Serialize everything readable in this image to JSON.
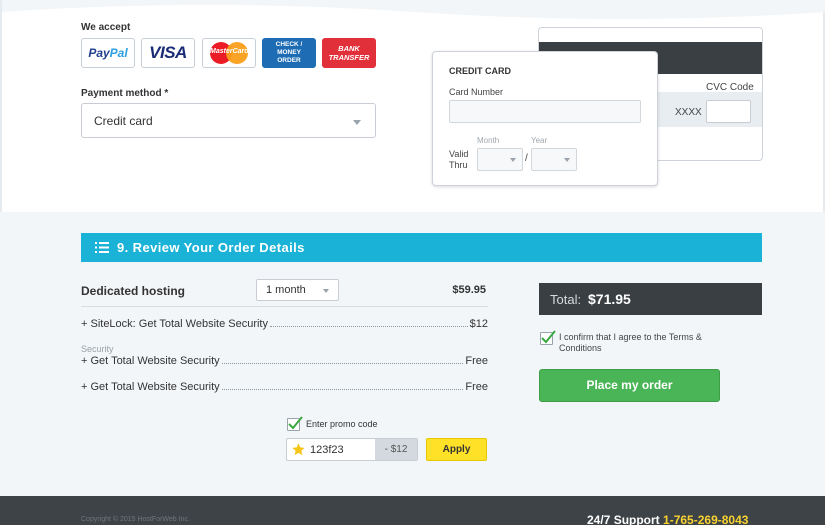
{
  "payment": {
    "we_accept_label": "We accept",
    "logos": {
      "paypal_a": "Pay",
      "paypal_b": "Pal",
      "visa": "VISA",
      "mastercard": "MasterCard",
      "check_line1": "CHECK /",
      "check_line2": "MONEY ORDER",
      "bank_line1": "BANK",
      "bank_line2": "TRANSFER"
    },
    "method_label": "Payment method *",
    "method_value": "Credit card"
  },
  "credit_card": {
    "title": "CREDIT CARD",
    "card_number_label": "Card Number",
    "card_number_value": "",
    "month_label": "Month",
    "year_label": "Year",
    "valid_thru_line1": "Valid",
    "valid_thru_line2": "Thru",
    "slash": "/",
    "cvc_label": "CVC Code",
    "card_masked": "XXXX",
    "cvc_value": ""
  },
  "review": {
    "title": "9. Review Your Order Details",
    "product_name": "Dedicated hosting",
    "duration": "1 month",
    "product_price": "$59.95",
    "addons": [
      {
        "name": "+ SiteLock: Get Total Website Security",
        "price": "$12"
      },
      {
        "name": "+ Get Total Website Security",
        "price": "Free"
      },
      {
        "name": "+ Get Total Website Security",
        "price": "Free"
      }
    ],
    "security_caption": "Security",
    "promo": {
      "checkbox_label": "Enter promo code",
      "checked": true,
      "code": "123f23",
      "discount": "- $12",
      "apply_label": "Apply"
    }
  },
  "summary": {
    "total_label": "Total:",
    "total_amount": "$71.95",
    "terms_text": "I confirm that I agree to the Terms & Conditions",
    "terms_checked": true,
    "order_button": "Place my order"
  },
  "footer": {
    "copyright": "Copyright © 2015 HostForWeb Inc.",
    "support_label": "24/7 Support",
    "support_phone": "1-765-269-8043"
  },
  "colors": {
    "accent": "#1ab2d6",
    "order_button": "#4ab556",
    "apply_button": "#ffe227",
    "total_bg": "#3a3f44",
    "footer_bg": "#3d4347",
    "phone": "#f8d330"
  },
  "icons": {
    "header": "list-icon",
    "promo": "star-icon",
    "checkmark": "checkmark-icon",
    "caret": "chevron-down-icon"
  }
}
